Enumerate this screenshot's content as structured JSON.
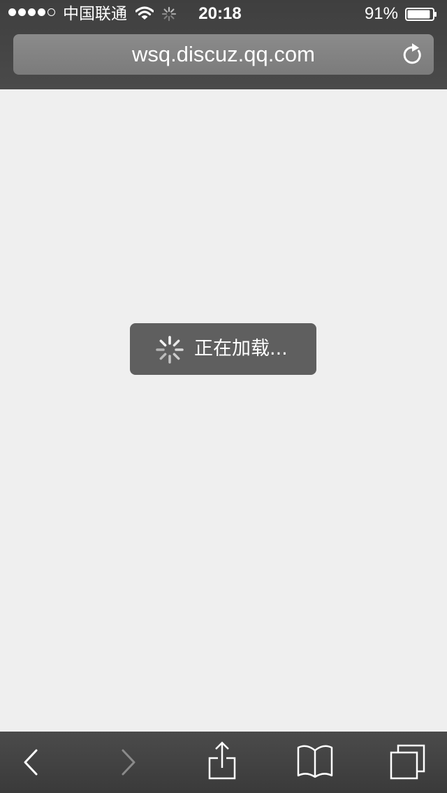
{
  "status_bar": {
    "carrier": "中国联通",
    "time": "20:18",
    "battery_percent": "91%",
    "signal_bars": 4,
    "signal_max": 5,
    "battery_level": 0.91
  },
  "url_bar": {
    "url": "wsq.discuz.qq.com"
  },
  "loading": {
    "text": "正在加载..."
  },
  "toolbar": {
    "buttons": [
      "back",
      "forward",
      "share",
      "bookmarks",
      "tabs"
    ]
  },
  "icons": {
    "wifi": "wifi-icon",
    "activity": "activity-spinner-icon",
    "battery": "battery-icon",
    "reload": "reload-icon",
    "loading_spinner": "loading-spinner-icon",
    "back": "chevron-left-icon",
    "forward": "chevron-right-icon",
    "share": "share-icon",
    "bookmarks": "book-icon",
    "tabs": "tabs-icon"
  },
  "colors": {
    "chrome": "#444444",
    "url_field": "#848484",
    "page_background": "#efefef",
    "loading_box": "#5f5f5f",
    "disabled_icon": "#8a8a8a"
  }
}
